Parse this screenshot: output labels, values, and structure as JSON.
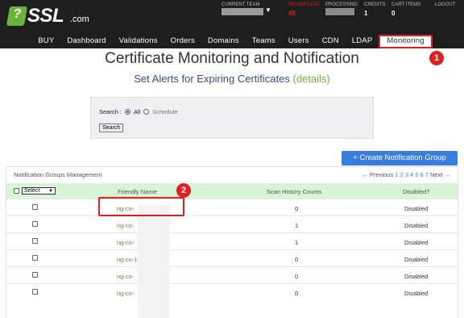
{
  "header": {
    "logo_text": "SSL",
    "logo_suffix": ".com",
    "current_team_label": "CURRENT TEAM",
    "incomplete_label": "INCOMPLETE",
    "incomplete_value": "49",
    "processing_label": "PROCESSING",
    "credits_label": "CREDITS",
    "credits_value": "1",
    "cart_label": "CART ITEMS",
    "cart_value": "0",
    "logout_label": "LOGOUT"
  },
  "nav": {
    "items": [
      "BUY",
      "Dashboard",
      "Validations",
      "Orders",
      "Domains",
      "Teams",
      "Users",
      "CDN",
      "LDAP",
      "Monitoring"
    ],
    "active": "Monitoring"
  },
  "callouts": [
    "1",
    "2"
  ],
  "page": {
    "title": "Certificate Monitoring and Notification",
    "subtitle": "Set Alerts for Expiring Certificates",
    "subtitle_link": "(details)"
  },
  "search": {
    "label": "Search :",
    "option_all": "All",
    "option_schedule": "Schedule",
    "button": "Search"
  },
  "create_button": "+ Create Notification Group",
  "panel": {
    "title": "Notification Groups Management",
    "pager_prev": "← Previous",
    "pager_pages": "1 2 3 4 5 6 7",
    "pager_next": "Next →"
  },
  "table": {
    "select_label": "Select",
    "columns": [
      "Friendly Name",
      "Scan History Counts",
      "Disabled?"
    ],
    "rows": [
      {
        "name": "ng-co-",
        "scans": "0",
        "disabled": "Disabled"
      },
      {
        "name": "ng-co-",
        "scans": "1",
        "disabled": "Disabled"
      },
      {
        "name": "ng-co-",
        "scans": "1",
        "disabled": "Disabled"
      },
      {
        "name": "ng-co-1",
        "scans": "0",
        "disabled": "Disabled"
      },
      {
        "name": "ng-co-",
        "scans": "0",
        "disabled": "Disabled"
      },
      {
        "name": "ng-co-",
        "scans": "0",
        "disabled": "Disabled"
      }
    ]
  },
  "colors": {
    "accent_green": "#6cb33e",
    "highlight_red": "#e02020",
    "header_bg": "#1e1e1e",
    "button_blue": "#3a7de0",
    "table_header_green": "#d6f5d6"
  }
}
